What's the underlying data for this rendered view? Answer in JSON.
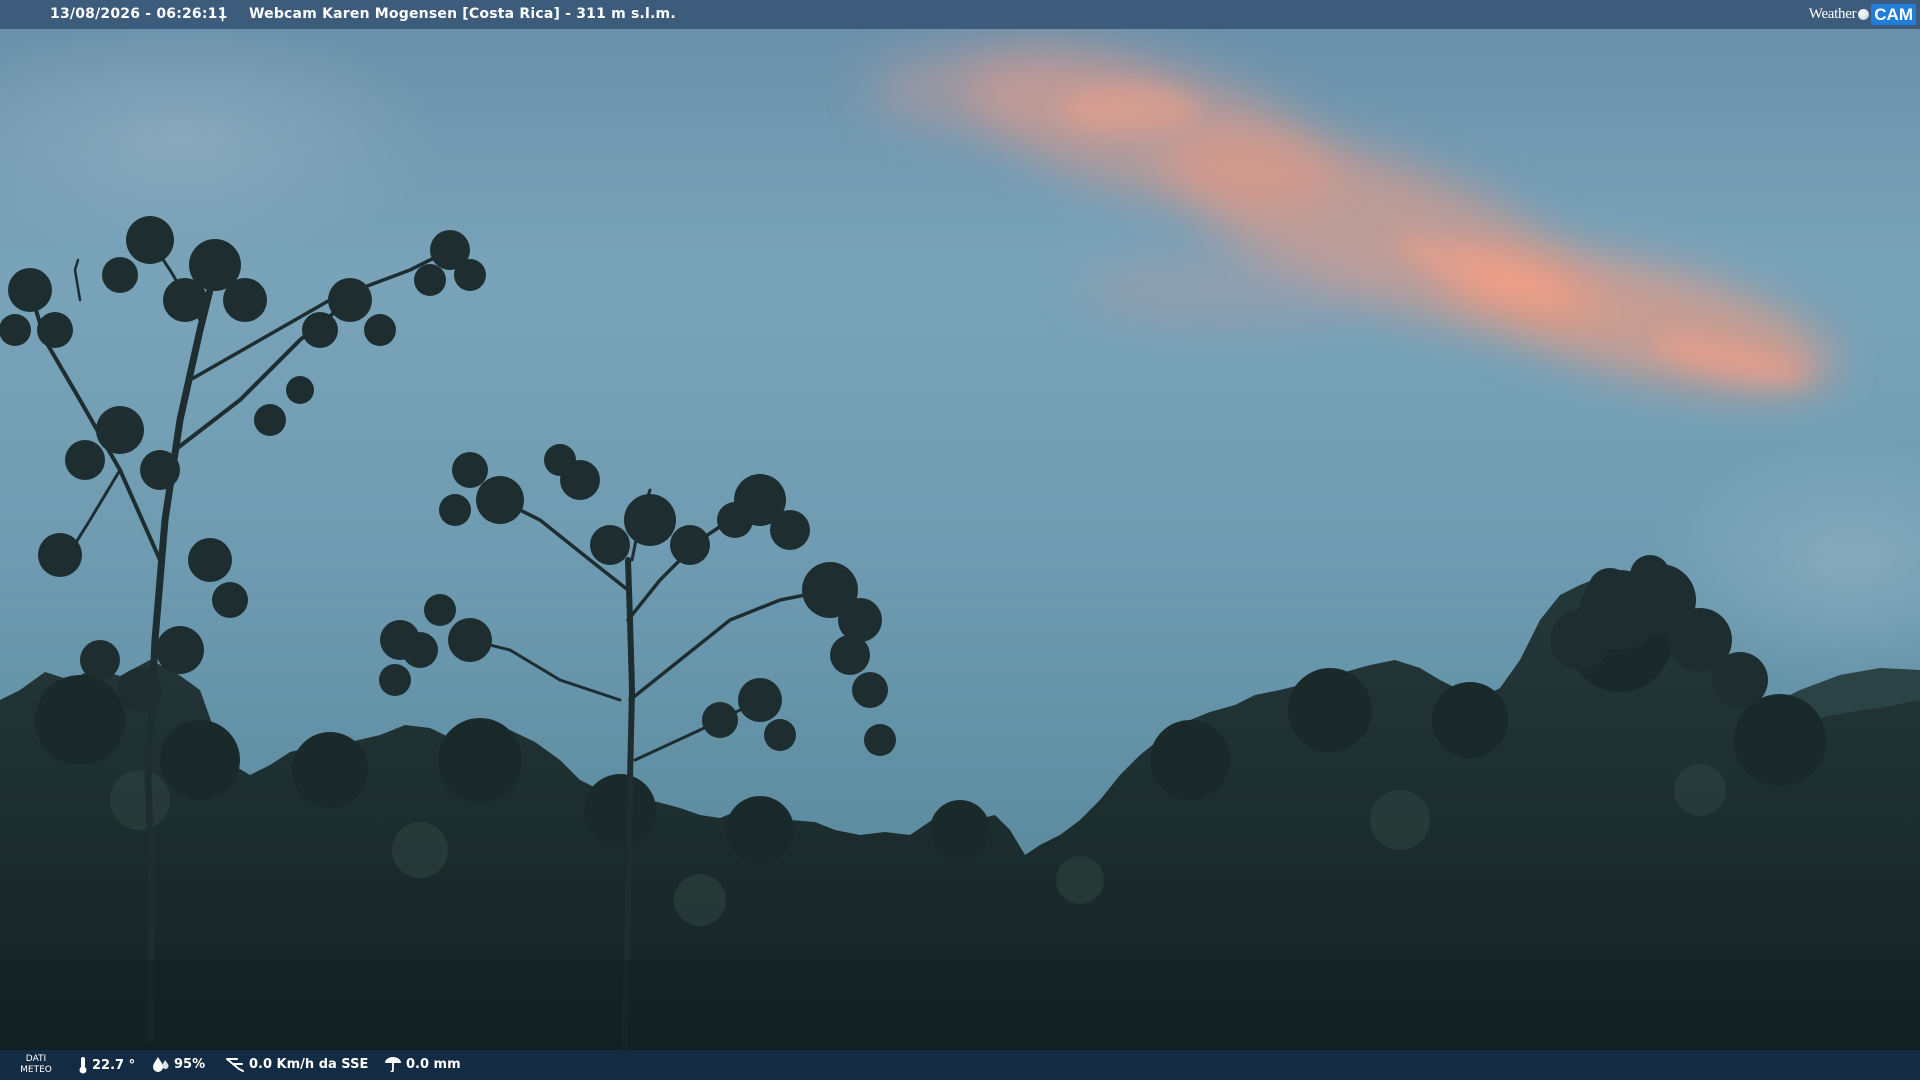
{
  "header": {
    "timestamp": "13/08/2026 - 06:26:11",
    "separator": "|",
    "title": "Webcam Karen Mogensen [Costa Rica]  - 311 m s.l.m."
  },
  "brand": {
    "weather_text": "Weather",
    "cam_text": "CAM"
  },
  "weather_strip": {
    "dati_line1": "DATI",
    "dati_line2": "METEO",
    "temperature": "22.7 °",
    "humidity": "95%",
    "wind": "0.0 Km/h da SSE",
    "rain": "0.0 mm",
    "icons": [
      "thermometer-icon",
      "humidity-icon",
      "wind-icon",
      "rain-gauge-icon"
    ]
  },
  "colors": {
    "sky_top": "#6b91ab",
    "sky_mid": "#7ba6bb",
    "sky_low": "#5f8ea2",
    "pink_cloud": "#e59a86",
    "canopy": "#1c2c2c",
    "header_bar": "#3a5878",
    "footer_bar": "#162d46",
    "brand_blue": "#1e7ed8"
  }
}
